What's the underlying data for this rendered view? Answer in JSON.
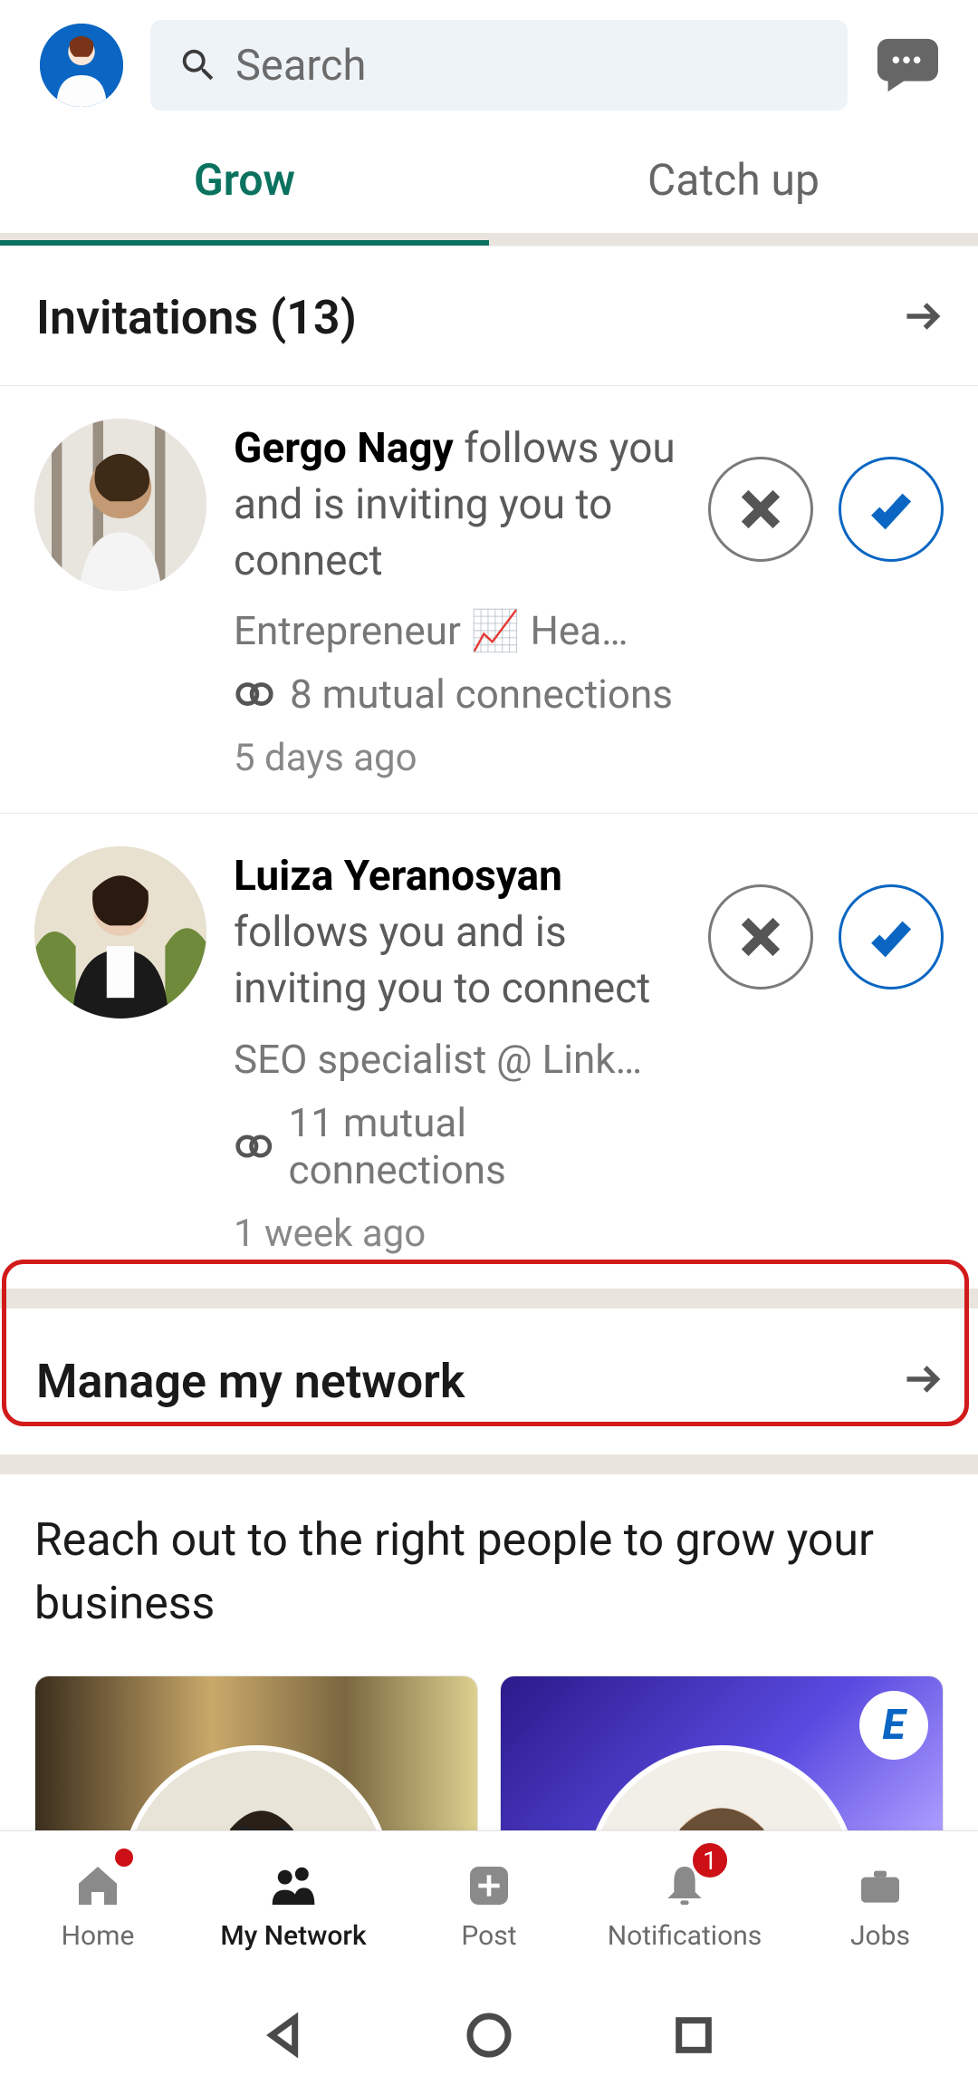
{
  "header": {
    "search_placeholder": "Search"
  },
  "tabs": {
    "grow": "Grow",
    "catch_up": "Catch up"
  },
  "invitations": {
    "title": "Invitations (13)"
  },
  "inv": [
    {
      "name": "Gergo Nagy",
      "rest": " follows you and is inviting you to connect",
      "headline": "Entrepreneur 📈 Hea…",
      "mutual": "8 mutual connections",
      "time": "5 days ago"
    },
    {
      "name": "Luiza Yeranosyan",
      "rest": " follows you and is inviting you to connect",
      "headline": "SEO specialist @ Link…",
      "mutual": "11 mutual connections",
      "time": "1 week ago"
    }
  ],
  "manage": {
    "title": "Manage my network"
  },
  "reach": {
    "title": "Reach out to the right people to grow your business"
  },
  "card_badge": "E",
  "nav": {
    "home": "Home",
    "network": "My Network",
    "post": "Post",
    "notif": "Notifications",
    "notif_badge": "1",
    "jobs": "Jobs"
  }
}
